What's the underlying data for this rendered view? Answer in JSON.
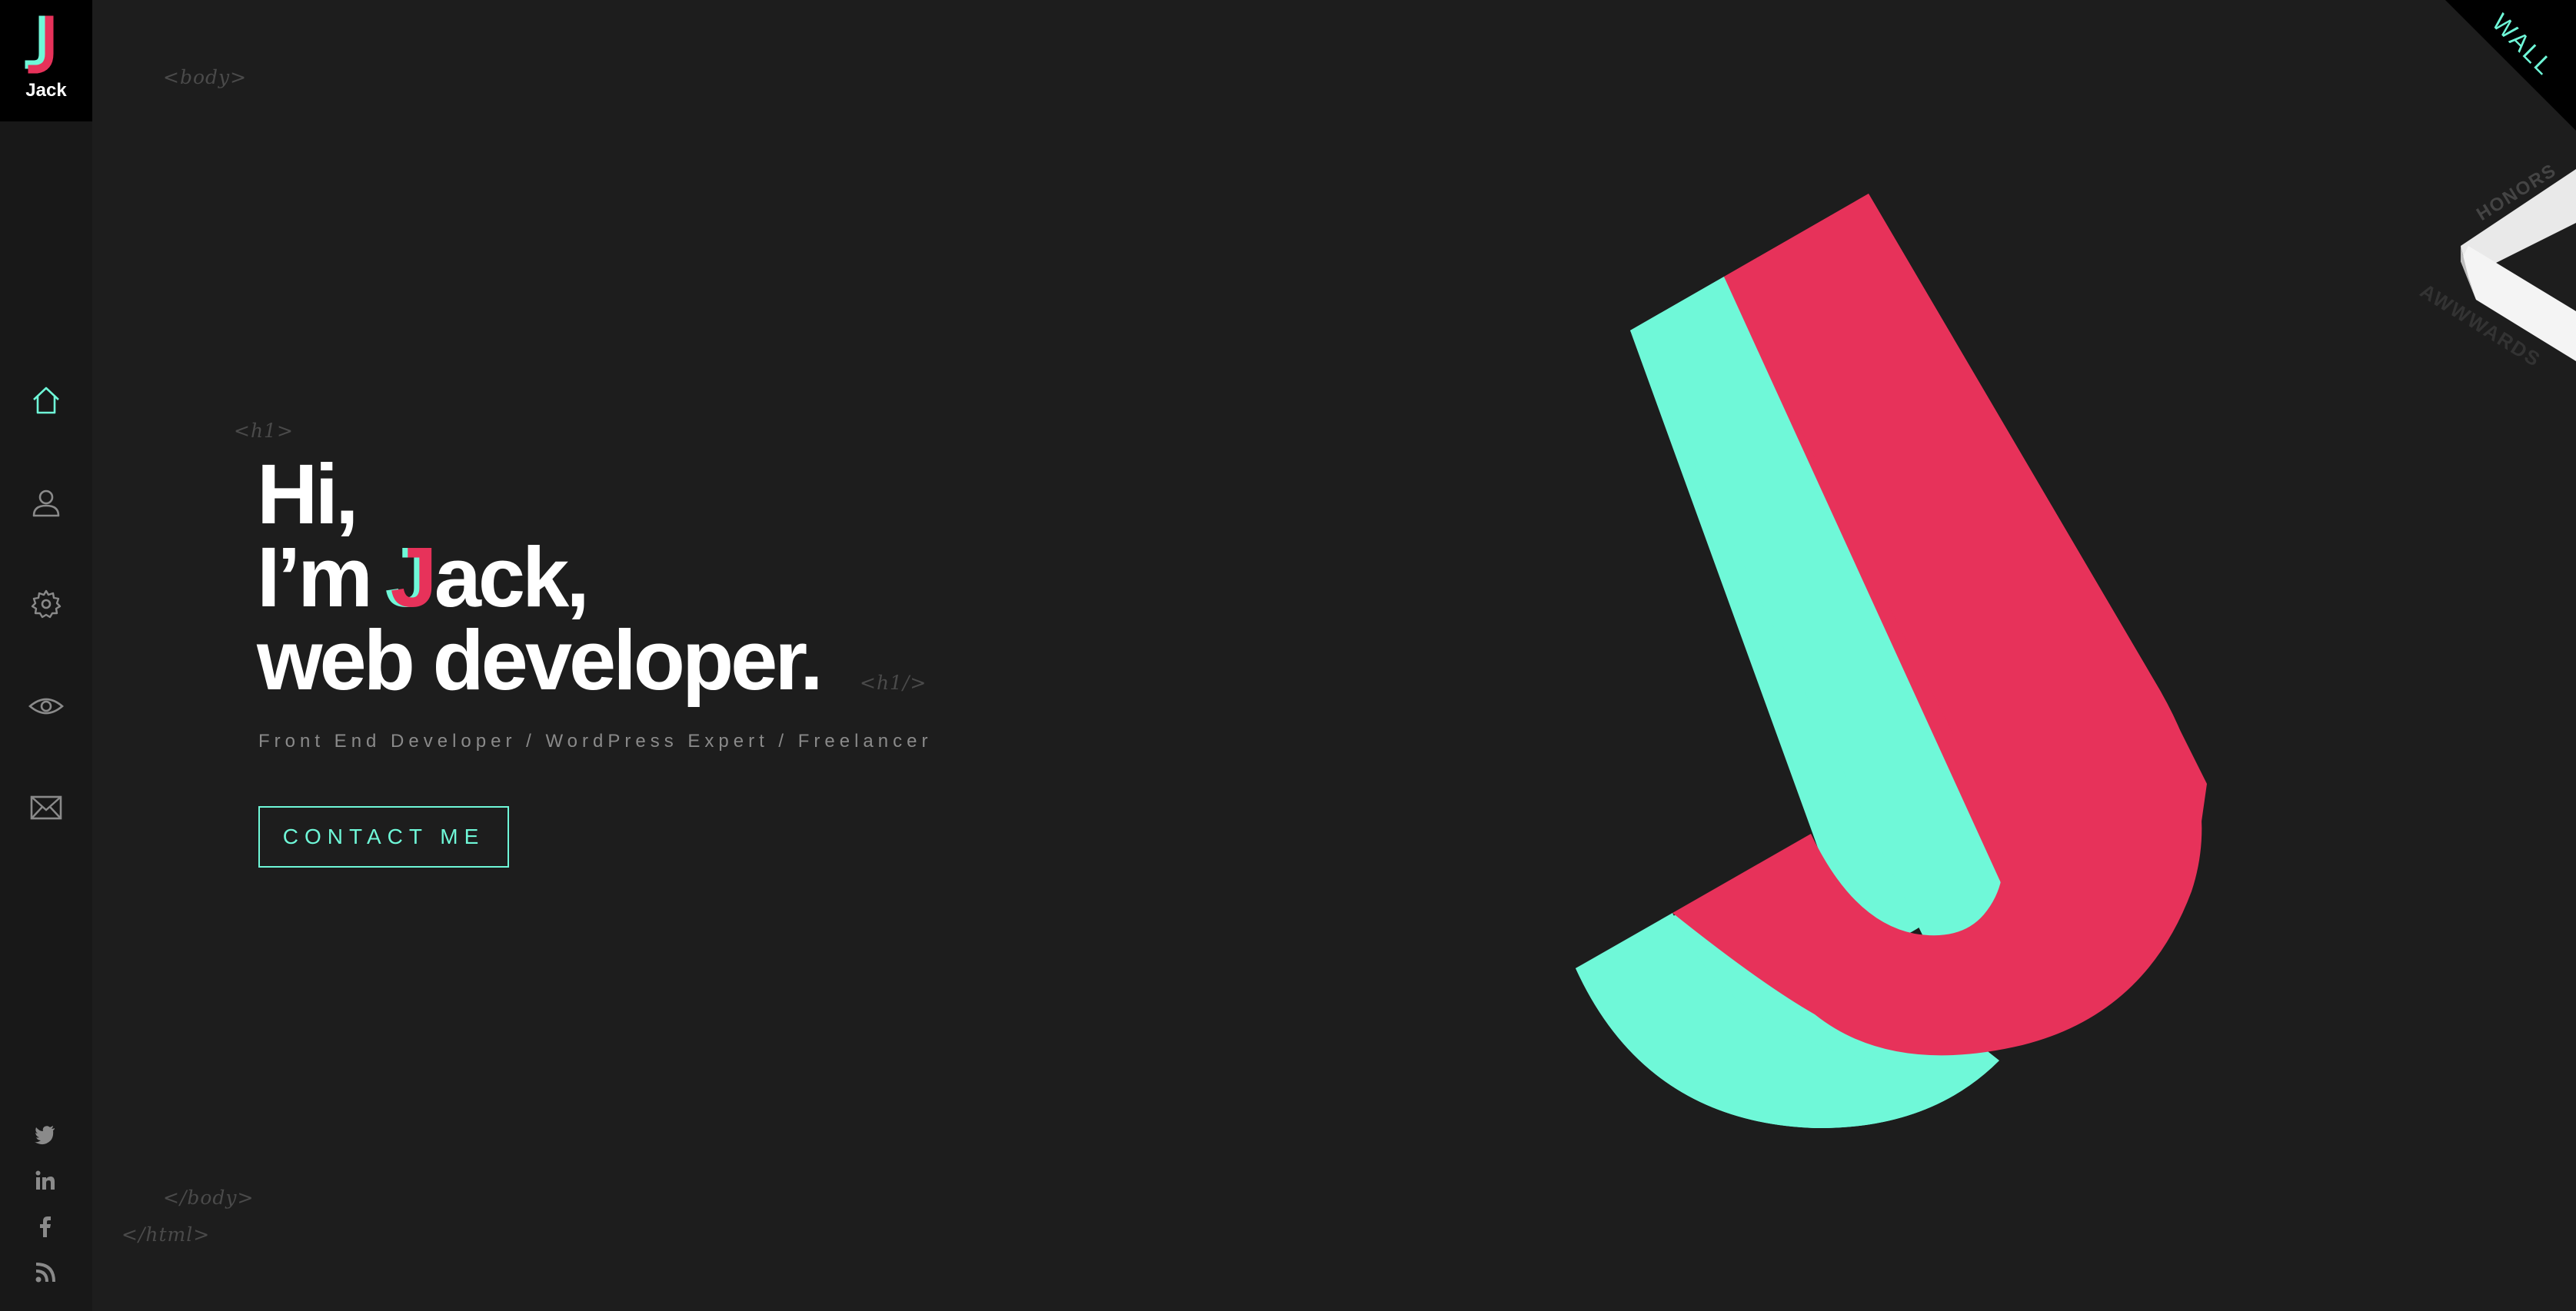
{
  "brand": {
    "logo_letter": "J",
    "name": "Jack"
  },
  "nav": [
    {
      "icon": "home-icon",
      "active": true
    },
    {
      "icon": "user-icon",
      "active": false
    },
    {
      "icon": "gear-icon",
      "active": false
    },
    {
      "icon": "eye-icon",
      "active": false
    },
    {
      "icon": "mail-icon",
      "active": false
    }
  ],
  "social": [
    "twitter-icon",
    "linkedin-icon",
    "facebook-icon",
    "rss-icon"
  ],
  "code_tags": {
    "body_open": "<body>",
    "h1_open": "<h1>",
    "h1_close": "<h1/>",
    "body_close": "</body>",
    "html_close": "</html>"
  },
  "hero": {
    "line1": "Hi,",
    "line2_prefix": "I’m ",
    "line2_letter": "J",
    "line2_suffix": "ack,",
    "line3": "web developer.",
    "subtitle": "Front End Developer / WordPress Expert / Freelancer",
    "cta_label": "CONTACT ME"
  },
  "corner_banner": {
    "label": "WALL"
  },
  "awards": {
    "top_label": "HONORS",
    "bottom_label": "AWWWARDS"
  },
  "colors": {
    "accent_mint": "#6ff8d8",
    "accent_pink": "#e7325a",
    "background": "#1d1d1d",
    "sidebar": "#181818"
  }
}
